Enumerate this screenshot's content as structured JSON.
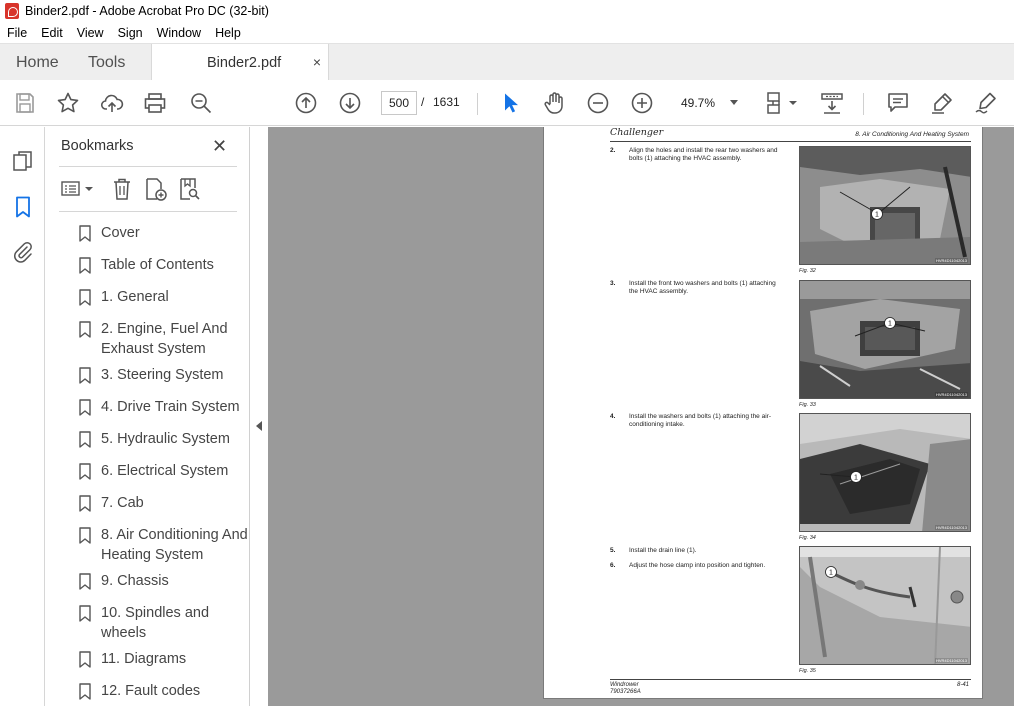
{
  "window": {
    "title": "Binder2.pdf - Adobe Acrobat Pro DC (32-bit)"
  },
  "menu": [
    "File",
    "Edit",
    "View",
    "Sign",
    "Window",
    "Help"
  ],
  "tabs": {
    "home": "Home",
    "tools": "Tools",
    "document": "Binder2.pdf",
    "close_glyph": "×"
  },
  "toolbar": {
    "page_current": "500",
    "page_separator": "/",
    "page_total": "1631",
    "zoom": "49.7%"
  },
  "bookmarks": {
    "title": "Bookmarks",
    "close_glyph": "✕",
    "items": [
      {
        "label": "Cover"
      },
      {
        "label": "Table of Contents"
      },
      {
        "label": "1. General"
      },
      {
        "label": "2. Engine, Fuel And Exhaust System"
      },
      {
        "label": "3. Steering System"
      },
      {
        "label": "4. Drive Train System"
      },
      {
        "label": "5. Hydraulic System"
      },
      {
        "label": "6. Electrical System"
      },
      {
        "label": "7. Cab"
      },
      {
        "label": "8. Air Conditioning And Heating System"
      },
      {
        "label": "9. Chassis"
      },
      {
        "label": "10. Spindles and wheels"
      },
      {
        "label": "11. Diagrams"
      },
      {
        "label": "12. Fault codes"
      }
    ]
  },
  "page": {
    "logo": "Challenger",
    "section": "8. Air Conditioning And Heating System",
    "steps": [
      {
        "num": "2.",
        "text": "Align the holes and install the rear two washers and bolts (1) attaching the HVAC assembly."
      },
      {
        "num": "3.",
        "text": "Install the front two washers and bolts (1) attaching the HVAC assembly."
      },
      {
        "num": "4.",
        "text": "Install the washers and bolts (1) attaching the air-conditioning intake."
      },
      {
        "num": "5.",
        "text": "Install the drain line (1)."
      },
      {
        "num": "6.",
        "text": "Adjust the hose clamp into position and tighten."
      }
    ],
    "figures": [
      {
        "caption": "Fig. 32",
        "code": "HVR4D11042013",
        "callout": "1"
      },
      {
        "caption": "Fig. 33",
        "code": "HVR4D11042013",
        "callout": "1"
      },
      {
        "caption": "Fig. 34",
        "code": "HVR4D11042013",
        "callout": "1"
      },
      {
        "caption": "Fig. 35",
        "code": "HVR4D11042013",
        "callout": "1"
      }
    ],
    "footer_left_1": "Windrower",
    "footer_left_2": "79037266A",
    "footer_right": "8-41"
  },
  "colors": {
    "accent": "#1473e6",
    "icon": "#555555",
    "doc_bg": "#9a9a9a",
    "acrobat_red": "#d8342b"
  }
}
